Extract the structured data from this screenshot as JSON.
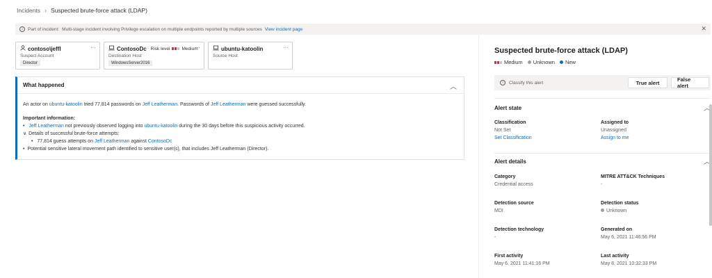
{
  "breadcrumb": {
    "root": "Incidents",
    "current": "Suspected brute-force attack (LDAP)"
  },
  "banner": {
    "prefix": "Part of incident:",
    "text": "Multi-stage incident involving Privilege escalation on multiple endpoints reported by multiple sources",
    "link": "View incident page"
  },
  "cards": {
    "account": {
      "name": "contoso\\jeffl",
      "role": "Suspect Account",
      "tag": "Director"
    },
    "dest": {
      "name": "ContosoDc",
      "risk_label": "Risk level",
      "risk_value": "Medium",
      "role": "Destination Host",
      "tag": "WindowsServer2016"
    },
    "source": {
      "name": "ubuntu-katoolin",
      "role": "Source Host"
    }
  },
  "what_happened": {
    "title": "What happened",
    "s1_pre": "An actor on ",
    "s1_host": "ubuntu-katoolin",
    "s1_mid": " tried 77,814 passwords on ",
    "s1_user": "Jeff Leatherman",
    "s1_mid2": ". Passwords of ",
    "s1_user2": "Jeff Leatherman",
    "s1_post": " were guessed successfully.",
    "important": "Important information:",
    "b1_user": "Jeff Leatherman",
    "b1_mid": " not previously observed logging into ",
    "b1_host": "ubuntu-katoolin",
    "b1_post": " during the 30 days before this suspicious activity occurred.",
    "b2": "Details of successful brute-force attempts:",
    "b2a_pre": "77,814 guess attempts on ",
    "b2a_user": "Jeff Leatherman",
    "b2a_mid": " against ",
    "b2a_host": "ContosoDc",
    "b3": "Potential sensitive lateral movement path identified to sensitive user(s), that includes Jeff Leatherman (Director)."
  },
  "panel": {
    "title": "Suspected brute-force attack (LDAP)",
    "severity": "Medium",
    "determination": "Unknown",
    "status": "New",
    "classify_text": "Classify this alert",
    "true_alert": "True alert",
    "false_alert": "False alert",
    "alert_state": {
      "title": "Alert state",
      "classification_label": "Classification",
      "classification_value": "Not Set",
      "classification_link": "Set Classification",
      "assigned_label": "Assigned to",
      "assigned_value": "Unassigned",
      "assigned_link": "Assign to me"
    },
    "alert_details": {
      "title": "Alert details",
      "category_label": "Category",
      "category_value": "Credential access",
      "mitre_label": "MITRE ATT&CK Techniques",
      "mitre_value": "-",
      "det_source_label": "Detection source",
      "det_source_value": "MDI",
      "det_status_label": "Detection status",
      "det_status_value": "Unknown",
      "det_tech_label": "Detection technology",
      "det_tech_value": "-",
      "generated_label": "Generated on",
      "generated_value": "May 6, 2021 11:46:56 PM",
      "first_label": "First activity",
      "first_value": "May 6, 2021 11:41:16 PM",
      "last_label": "Last activity",
      "last_value": "May 8, 2021 10:32:33 PM"
    }
  },
  "colors": {
    "accent": "#0f6cbd",
    "severity": "#d13438",
    "new": "#0f6cbd",
    "unknown": "#a19f9d"
  }
}
